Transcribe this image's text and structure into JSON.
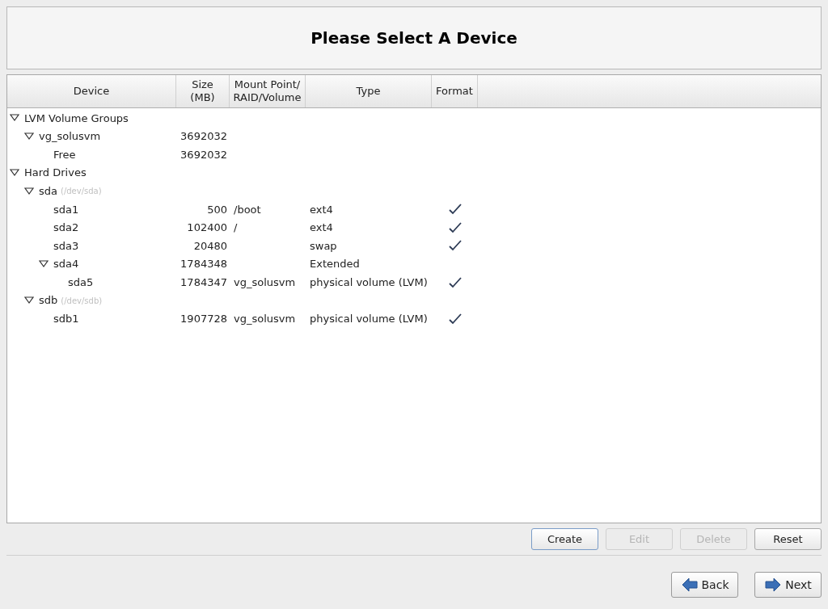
{
  "title": "Please Select A Device",
  "table": {
    "columns": [
      "Device",
      "Size\n(MB)",
      "Mount Point/\nRAID/Volume",
      "Type",
      "Format"
    ],
    "rows": [
      {
        "name": "LVM Volume Groups",
        "expanded": true,
        "format": false,
        "children": [
          {
            "name": "vg_solusvm",
            "size": "3692032",
            "expanded": true,
            "format": false,
            "children": [
              {
                "name": "Free",
                "size": "3692032",
                "format": false
              }
            ]
          }
        ]
      },
      {
        "name": "Hard Drives",
        "expanded": true,
        "format": false,
        "children": [
          {
            "name": "sda",
            "path": "(/dev/sda)",
            "expanded": true,
            "format": false,
            "children": [
              {
                "name": "sda1",
                "size": "500",
                "mount": "/boot",
                "type": "ext4",
                "format": true
              },
              {
                "name": "sda2",
                "size": "102400",
                "mount": "/",
                "type": "ext4",
                "format": true
              },
              {
                "name": "sda3",
                "size": "20480",
                "type": "swap",
                "format": true
              },
              {
                "name": "sda4",
                "size": "1784348",
                "type": "Extended",
                "expanded": true,
                "format": false,
                "children": [
                  {
                    "name": "sda5",
                    "size": "1784347",
                    "mount": "vg_solusvm",
                    "type": "physical volume (LVM)",
                    "format": true
                  }
                ]
              }
            ]
          },
          {
            "name": "sdb",
            "path": "(/dev/sdb)",
            "expanded": true,
            "format": false,
            "children": [
              {
                "name": "sdb1",
                "size": "1907728",
                "mount": "vg_solusvm",
                "type": "physical volume (LVM)",
                "format": true
              }
            ]
          }
        ]
      }
    ]
  },
  "actions": [
    {
      "label": "Create",
      "disabled": false,
      "focused": true
    },
    {
      "label": "Edit",
      "disabled": true,
      "focused": false
    },
    {
      "label": "Delete",
      "disabled": true,
      "focused": false
    },
    {
      "label": "Reset",
      "disabled": false,
      "focused": false
    }
  ],
  "navigation": [
    {
      "label": "Back",
      "kind": "back"
    },
    {
      "label": "Next",
      "kind": "next"
    }
  ]
}
